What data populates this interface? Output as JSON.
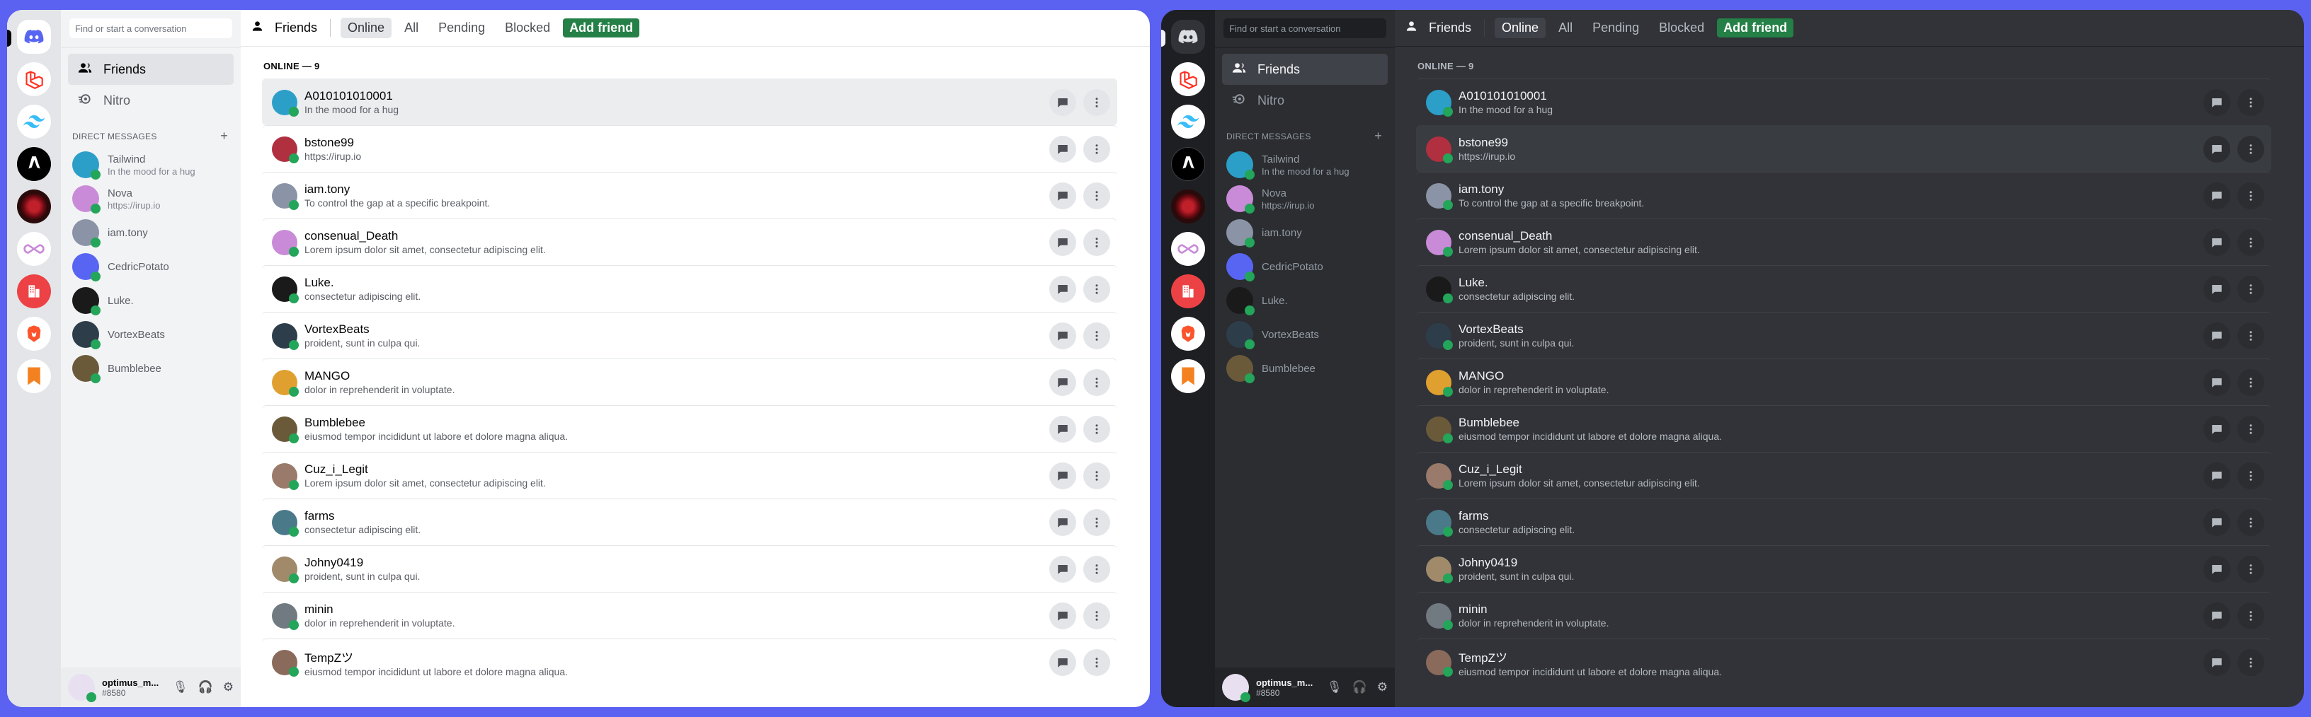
{
  "search": {
    "placeholder": "Find or start a conversation"
  },
  "nav": [
    {
      "label": "Friends",
      "icon": "friends-icon"
    },
    {
      "label": "Nitro",
      "icon": "nitro-icon"
    }
  ],
  "dm_header": "DIRECT MESSAGES",
  "dm_add": "+",
  "dms": [
    {
      "name": "Tailwind",
      "status": "In the mood for a hug",
      "color": "#2c9fc9"
    },
    {
      "name": "Nova",
      "status": "https://irup.io",
      "color": "#c98bd8"
    },
    {
      "name": "iam.tony",
      "status": "",
      "color": "#8a94a6"
    },
    {
      "name": "CedricPotato",
      "status": "",
      "color": "#5865f2"
    },
    {
      "name": "Luke.",
      "status": "",
      "color": "#1a1a1a"
    },
    {
      "name": "VortexBeats",
      "status": "",
      "color": "#2d3e4a"
    },
    {
      "name": "Bumblebee",
      "status": "",
      "color": "#6b5a3a"
    }
  ],
  "user": {
    "name": "optimus_m...",
    "tag": "#8580"
  },
  "topbar": {
    "title": "Friends",
    "tabs": [
      "Online",
      "All",
      "Pending",
      "Blocked"
    ],
    "add_friend": "Add friend"
  },
  "online_header": "ONLINE — 9",
  "friends": [
    {
      "name": "A010101010001",
      "status": "In the mood for a hug",
      "color": "#2c9fc9"
    },
    {
      "name": "bstone99",
      "status": "https://irup.io",
      "color": "#b03040"
    },
    {
      "name": "iam.tony",
      "status": "To control the gap at a specific breakpoint.",
      "color": "#8a94a6"
    },
    {
      "name": "consenual_Death",
      "status": "Lorem ipsum dolor sit amet, consectetur adipiscing elit.",
      "color": "#c98bd8"
    },
    {
      "name": "Luke.",
      "status": "consectetur adipiscing elit.",
      "color": "#1a1a1a"
    },
    {
      "name": "VortexBeats",
      "status": "proident, sunt in culpa qui.",
      "color": "#2d3e4a"
    },
    {
      "name": "MANGO",
      "status": "dolor in reprehenderit in voluptate.",
      "color": "#e0a030"
    },
    {
      "name": "Bumblebee",
      "status": "eiusmod tempor incididunt ut labore et dolore magna aliqua.",
      "color": "#6b5a3a"
    },
    {
      "name": "Cuz_i_Legit",
      "status": "Lorem ipsum dolor sit amet, consectetur adipiscing elit.",
      "color": "#9a7a6a"
    },
    {
      "name": "farms",
      "status": "consectetur adipiscing elit.",
      "color": "#4a7a8a"
    },
    {
      "name": "Johny0419",
      "status": "proident, sunt in culpa qui.",
      "color": "#a08a6a"
    },
    {
      "name": "minin",
      "status": "dolor in reprehenderit in voluptate.",
      "color": "#707a80"
    },
    {
      "name": "TempZツ",
      "status": "eiusmod tempor incididunt ut labore et dolore magna aliqua.",
      "color": "#8a6a5a"
    }
  ],
  "servers": [
    {
      "icon": "discord-home-icon",
      "bg": "#5865f2"
    },
    {
      "icon": "laravel-icon",
      "bg": "#ff2d20"
    },
    {
      "icon": "tailwind-icon",
      "bg": "#38bdf8"
    },
    {
      "icon": "astro-icon",
      "bg": "#000000"
    },
    {
      "icon": "rose-server-icon",
      "bg": "#3a0a0a"
    },
    {
      "icon": "loop-server-icon",
      "bg": "#c98bd8"
    },
    {
      "icon": "red-building-icon",
      "bg": "#ed4245"
    },
    {
      "icon": "brave-icon",
      "bg": "#fb542b"
    },
    {
      "icon": "orange-bookmark-icon",
      "bg": "#f48120"
    }
  ]
}
